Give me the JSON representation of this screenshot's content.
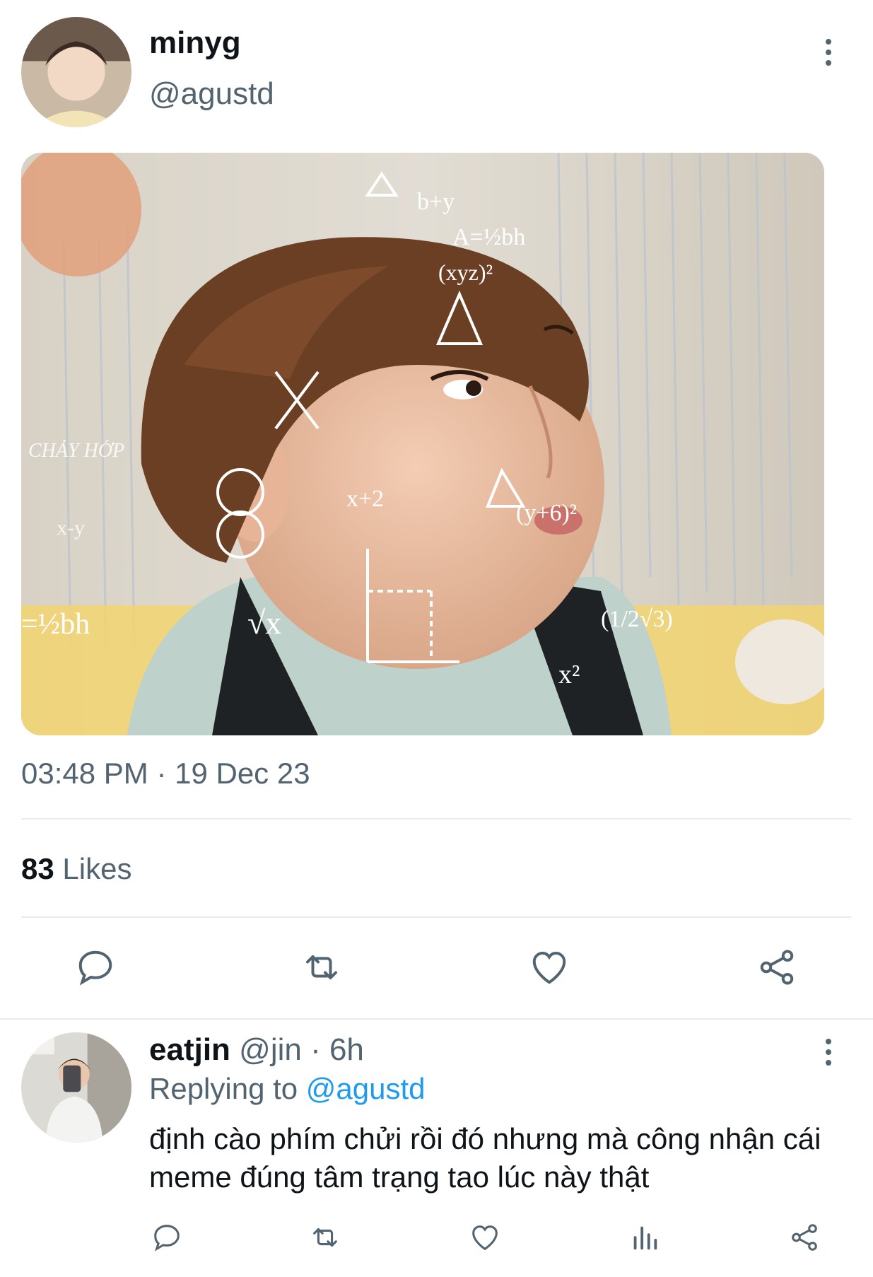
{
  "tweet": {
    "author_name": "minyg",
    "author_handle": "@agustd",
    "timestamp": "03:48 PM · 19 Dec 23",
    "likes_count": "83",
    "likes_label": "Likes",
    "media_overlay_text": {
      "watermark": "CHẢY HỚP",
      "eq1": "A=½bh",
      "eq2": "(xyz)²",
      "eq3": "b+y",
      "eq4": "x+2",
      "eq5": "(y+6)²",
      "eq6": "x²",
      "eq7": "=½bh",
      "eq8": "(1/2√3)",
      "eq9": "√x",
      "eq10": "x-y"
    }
  },
  "reply": {
    "author_name": "eatjin",
    "author_handle": "@jin",
    "time": "· 6h",
    "replying_prefix": "Replying to",
    "replying_to": "@agustd",
    "text": "định cào phím chửi rồi đó nhưng mà công nhận cái meme đúng tâm trạng tao lúc này thật"
  },
  "icons": {
    "reply": "comment-icon",
    "retweet": "retweet-icon",
    "like": "heart-icon",
    "share": "share-icon",
    "views": "analytics-icon",
    "more": "more-vertical-icon"
  },
  "colors": {
    "text_primary": "#0f1419",
    "text_secondary": "#536471",
    "link": "#1d9bf0",
    "divider": "#e6ecf0"
  }
}
